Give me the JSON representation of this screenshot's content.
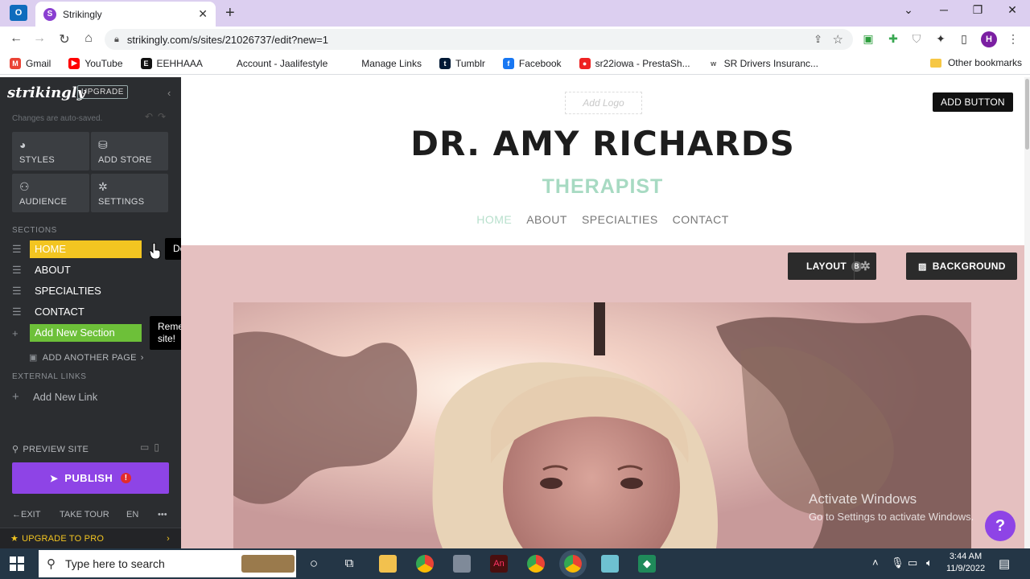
{
  "browser": {
    "tab_title": "Strikingly",
    "url": "strikingly.com/s/sites/21026737/edit?new=1",
    "profile_initial": "H",
    "bookmarks": [
      {
        "label": "Gmail",
        "color": "#ea4335",
        "glyph": "M"
      },
      {
        "label": "YouTube",
        "color": "#ff0000",
        "glyph": "▶"
      },
      {
        "label": "EEHHAAA",
        "color": "#111111",
        "glyph": "E"
      },
      {
        "label": "Account - Jaalifestyle",
        "color": "#ffffff",
        "glyph": ""
      },
      {
        "label": "Manage Links",
        "color": "#ffffff",
        "glyph": ""
      },
      {
        "label": "Tumblr",
        "color": "#001935",
        "glyph": "t"
      },
      {
        "label": "Facebook",
        "color": "#1877f2",
        "glyph": "f"
      },
      {
        "label": "sr22iowa - PrestaSh...",
        "color": "#e22",
        "glyph": "●"
      },
      {
        "label": "SR Drivers Insuranc...",
        "color": "#ffffff",
        "glyph": "w"
      }
    ],
    "other_bookmarks": "Other bookmarks"
  },
  "sidebar": {
    "logo": "strikingly",
    "upgrade_badge": "UPGRADE",
    "autosave": "Changes are auto-saved.",
    "tiles": [
      {
        "label": "STYLES",
        "icon": "palette-icon"
      },
      {
        "label": "ADD STORE",
        "icon": "store-icon"
      },
      {
        "label": "AUDIENCE",
        "icon": "people-icon"
      },
      {
        "label": "SETTINGS",
        "icon": "gear-icon"
      }
    ],
    "sections_header": "SECTIONS",
    "sections": [
      "HOME",
      "ABOUT",
      "SPECIALTIES",
      "CONTACT"
    ],
    "add_new_section": "Add New Section",
    "add_another_page": "ADD ANOTHER PAGE",
    "external_links_header": "EXTERNAL LINKS",
    "add_new_link": "Add New Link",
    "preview_site": "PREVIEW SITE",
    "publish": "PUBLISH",
    "footer": {
      "exit": "EXIT",
      "take_tour": "TAKE TOUR",
      "lang": "EN",
      "more": "•••"
    },
    "upgrade_pro": "UPGRADE TO PRO"
  },
  "tooltips": {
    "delete": "Delete this section",
    "remember": "Remember, you can add all kinds of content to your site!"
  },
  "site": {
    "add_logo": "Add Logo",
    "add_button": "ADD BUTTON",
    "title": "DR. AMY RICHARDS",
    "subtitle": "THERAPIST",
    "nav": [
      "HOME",
      "ABOUT",
      "SPECIALTIES",
      "CONTACT"
    ],
    "layout_label": "LAYOUT",
    "layout_badge": "B",
    "background_label": "BACKGROUND",
    "accent_color": "#a7dac2"
  },
  "watermark": {
    "line1": "Activate Windows",
    "line2": "Go to Settings to activate Windows."
  },
  "taskbar": {
    "search_placeholder": "Type here to search",
    "time": "3:44 AM",
    "date": "11/9/2022"
  }
}
